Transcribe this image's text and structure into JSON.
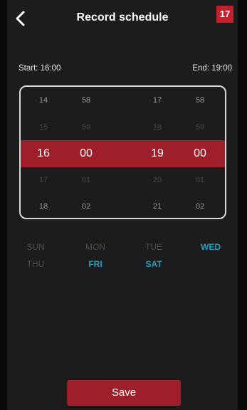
{
  "header": {
    "title": "Record schedule",
    "badge": "17"
  },
  "range": {
    "start_label": "Start: 16:00",
    "end_label": "End: 19:00"
  },
  "picker": {
    "start_hours": [
      "14",
      "15",
      "16",
      "17",
      "18"
    ],
    "start_minutes": [
      "58",
      "59",
      "00",
      "01",
      "02"
    ],
    "end_hours": [
      "17",
      "18",
      "19",
      "20",
      "21"
    ],
    "end_minutes": [
      "58",
      "59",
      "00",
      "01",
      "02"
    ],
    "selected_index": 2
  },
  "days": [
    {
      "label": "SUN",
      "active": false
    },
    {
      "label": "MON",
      "active": false
    },
    {
      "label": "TUE",
      "active": false
    },
    {
      "label": "WED",
      "active": true
    },
    {
      "label": "THU",
      "active": false
    },
    {
      "label": "FRI",
      "active": true
    },
    {
      "label": "SAT",
      "active": true
    }
  ],
  "colors": {
    "accent_red": "#9e1f2a",
    "badge_red": "#c2202b",
    "active_day": "#1f9ec4",
    "inactive_day": "#4d4d4d",
    "background": "#1c1c1c"
  },
  "footer": {
    "save_label": "Save"
  }
}
